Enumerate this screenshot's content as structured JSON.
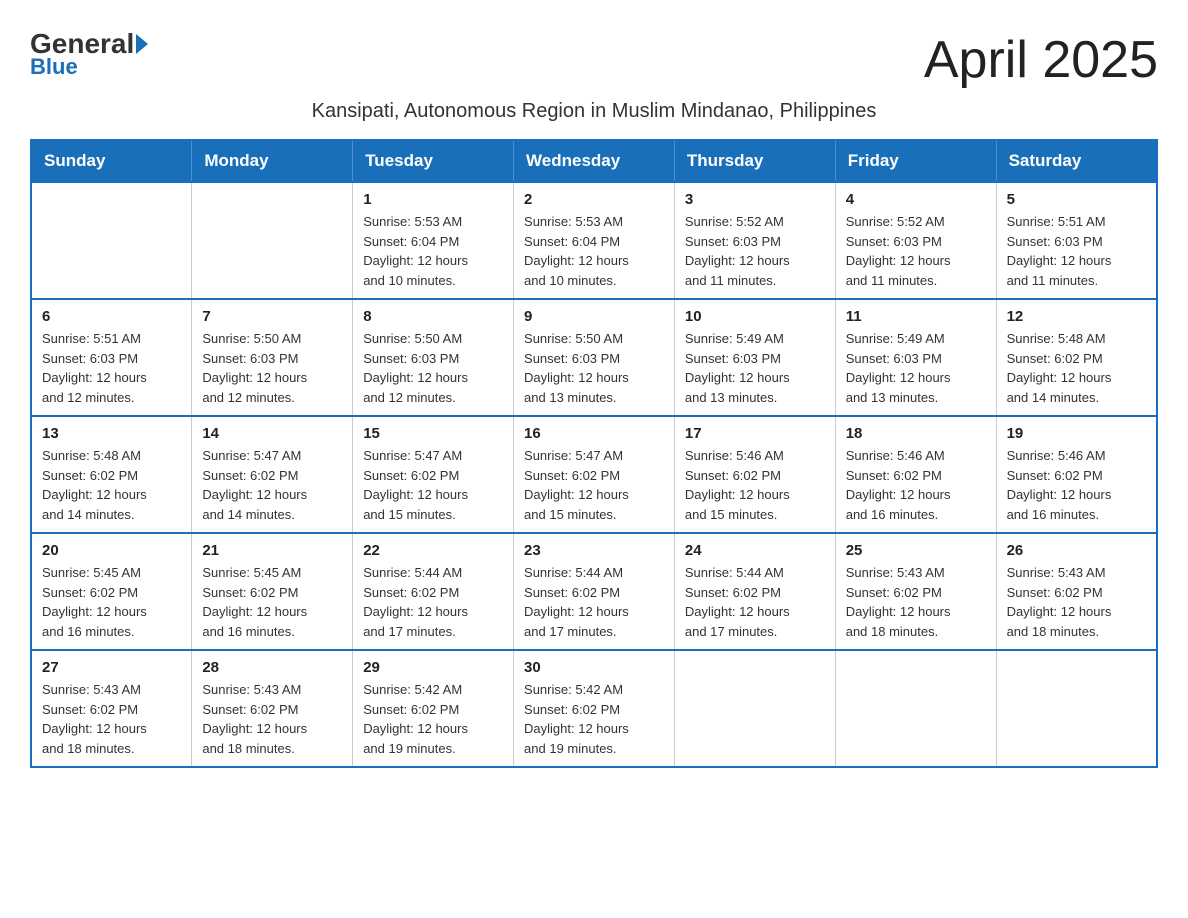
{
  "header": {
    "logo_general": "General",
    "logo_blue": "Blue",
    "month_title": "April 2025",
    "subtitle": "Kansipati, Autonomous Region in Muslim Mindanao, Philippines"
  },
  "days_of_week": [
    "Sunday",
    "Monday",
    "Tuesday",
    "Wednesday",
    "Thursday",
    "Friday",
    "Saturday"
  ],
  "weeks": [
    [
      {
        "day": "",
        "info": ""
      },
      {
        "day": "",
        "info": ""
      },
      {
        "day": "1",
        "info": "Sunrise: 5:53 AM\nSunset: 6:04 PM\nDaylight: 12 hours\nand 10 minutes."
      },
      {
        "day": "2",
        "info": "Sunrise: 5:53 AM\nSunset: 6:04 PM\nDaylight: 12 hours\nand 10 minutes."
      },
      {
        "day": "3",
        "info": "Sunrise: 5:52 AM\nSunset: 6:03 PM\nDaylight: 12 hours\nand 11 minutes."
      },
      {
        "day": "4",
        "info": "Sunrise: 5:52 AM\nSunset: 6:03 PM\nDaylight: 12 hours\nand 11 minutes."
      },
      {
        "day": "5",
        "info": "Sunrise: 5:51 AM\nSunset: 6:03 PM\nDaylight: 12 hours\nand 11 minutes."
      }
    ],
    [
      {
        "day": "6",
        "info": "Sunrise: 5:51 AM\nSunset: 6:03 PM\nDaylight: 12 hours\nand 12 minutes."
      },
      {
        "day": "7",
        "info": "Sunrise: 5:50 AM\nSunset: 6:03 PM\nDaylight: 12 hours\nand 12 minutes."
      },
      {
        "day": "8",
        "info": "Sunrise: 5:50 AM\nSunset: 6:03 PM\nDaylight: 12 hours\nand 12 minutes."
      },
      {
        "day": "9",
        "info": "Sunrise: 5:50 AM\nSunset: 6:03 PM\nDaylight: 12 hours\nand 13 minutes."
      },
      {
        "day": "10",
        "info": "Sunrise: 5:49 AM\nSunset: 6:03 PM\nDaylight: 12 hours\nand 13 minutes."
      },
      {
        "day": "11",
        "info": "Sunrise: 5:49 AM\nSunset: 6:03 PM\nDaylight: 12 hours\nand 13 minutes."
      },
      {
        "day": "12",
        "info": "Sunrise: 5:48 AM\nSunset: 6:02 PM\nDaylight: 12 hours\nand 14 minutes."
      }
    ],
    [
      {
        "day": "13",
        "info": "Sunrise: 5:48 AM\nSunset: 6:02 PM\nDaylight: 12 hours\nand 14 minutes."
      },
      {
        "day": "14",
        "info": "Sunrise: 5:47 AM\nSunset: 6:02 PM\nDaylight: 12 hours\nand 14 minutes."
      },
      {
        "day": "15",
        "info": "Sunrise: 5:47 AM\nSunset: 6:02 PM\nDaylight: 12 hours\nand 15 minutes."
      },
      {
        "day": "16",
        "info": "Sunrise: 5:47 AM\nSunset: 6:02 PM\nDaylight: 12 hours\nand 15 minutes."
      },
      {
        "day": "17",
        "info": "Sunrise: 5:46 AM\nSunset: 6:02 PM\nDaylight: 12 hours\nand 15 minutes."
      },
      {
        "day": "18",
        "info": "Sunrise: 5:46 AM\nSunset: 6:02 PM\nDaylight: 12 hours\nand 16 minutes."
      },
      {
        "day": "19",
        "info": "Sunrise: 5:46 AM\nSunset: 6:02 PM\nDaylight: 12 hours\nand 16 minutes."
      }
    ],
    [
      {
        "day": "20",
        "info": "Sunrise: 5:45 AM\nSunset: 6:02 PM\nDaylight: 12 hours\nand 16 minutes."
      },
      {
        "day": "21",
        "info": "Sunrise: 5:45 AM\nSunset: 6:02 PM\nDaylight: 12 hours\nand 16 minutes."
      },
      {
        "day": "22",
        "info": "Sunrise: 5:44 AM\nSunset: 6:02 PM\nDaylight: 12 hours\nand 17 minutes."
      },
      {
        "day": "23",
        "info": "Sunrise: 5:44 AM\nSunset: 6:02 PM\nDaylight: 12 hours\nand 17 minutes."
      },
      {
        "day": "24",
        "info": "Sunrise: 5:44 AM\nSunset: 6:02 PM\nDaylight: 12 hours\nand 17 minutes."
      },
      {
        "day": "25",
        "info": "Sunrise: 5:43 AM\nSunset: 6:02 PM\nDaylight: 12 hours\nand 18 minutes."
      },
      {
        "day": "26",
        "info": "Sunrise: 5:43 AM\nSunset: 6:02 PM\nDaylight: 12 hours\nand 18 minutes."
      }
    ],
    [
      {
        "day": "27",
        "info": "Sunrise: 5:43 AM\nSunset: 6:02 PM\nDaylight: 12 hours\nand 18 minutes."
      },
      {
        "day": "28",
        "info": "Sunrise: 5:43 AM\nSunset: 6:02 PM\nDaylight: 12 hours\nand 18 minutes."
      },
      {
        "day": "29",
        "info": "Sunrise: 5:42 AM\nSunset: 6:02 PM\nDaylight: 12 hours\nand 19 minutes."
      },
      {
        "day": "30",
        "info": "Sunrise: 5:42 AM\nSunset: 6:02 PM\nDaylight: 12 hours\nand 19 minutes."
      },
      {
        "day": "",
        "info": ""
      },
      {
        "day": "",
        "info": ""
      },
      {
        "day": "",
        "info": ""
      }
    ]
  ]
}
